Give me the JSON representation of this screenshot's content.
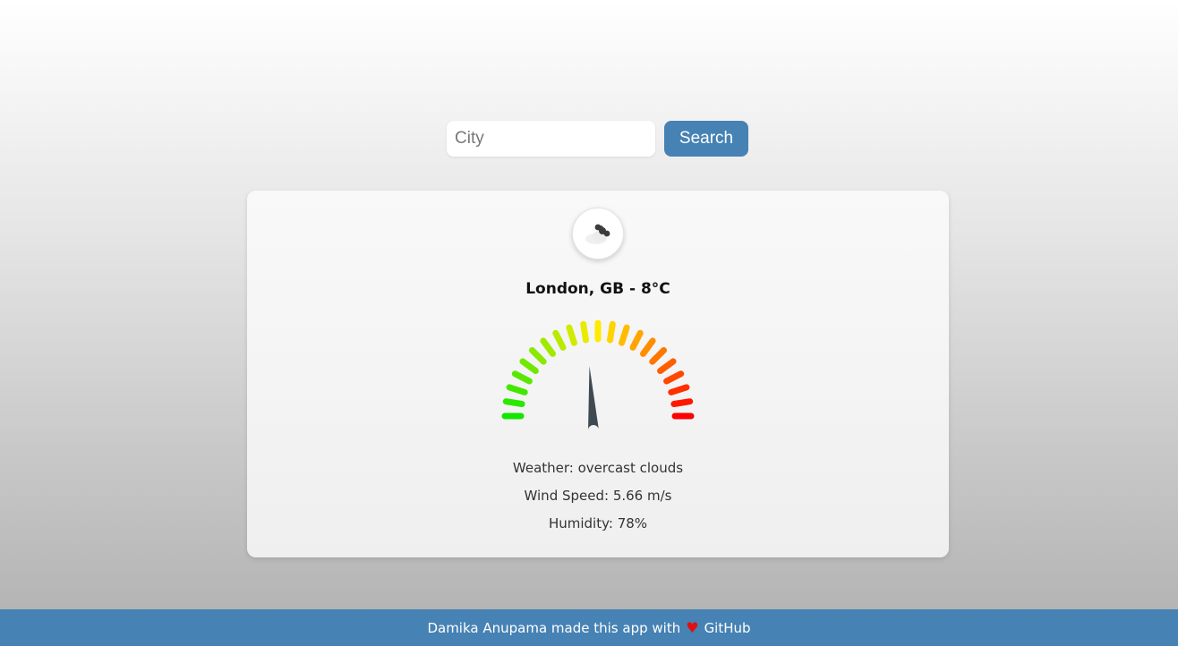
{
  "search": {
    "placeholder": "City",
    "value": "",
    "button_label": "Search"
  },
  "weather": {
    "icon": "overcast-clouds-icon",
    "title": "London, GB - 8°C",
    "description": "Weather: overcast clouds",
    "wind": "Wind Speed: 5.66 m/s",
    "humidity": "Humidity: 78%",
    "gauge_fraction": 0.48
  },
  "footer": {
    "text": "Damika Anupama made this app with",
    "heart_icon": "heart-icon",
    "link_label": "GitHub"
  },
  "colors": {
    "accent": "#4682b4",
    "needle": "#3d4a52",
    "heart": "#e01010"
  }
}
